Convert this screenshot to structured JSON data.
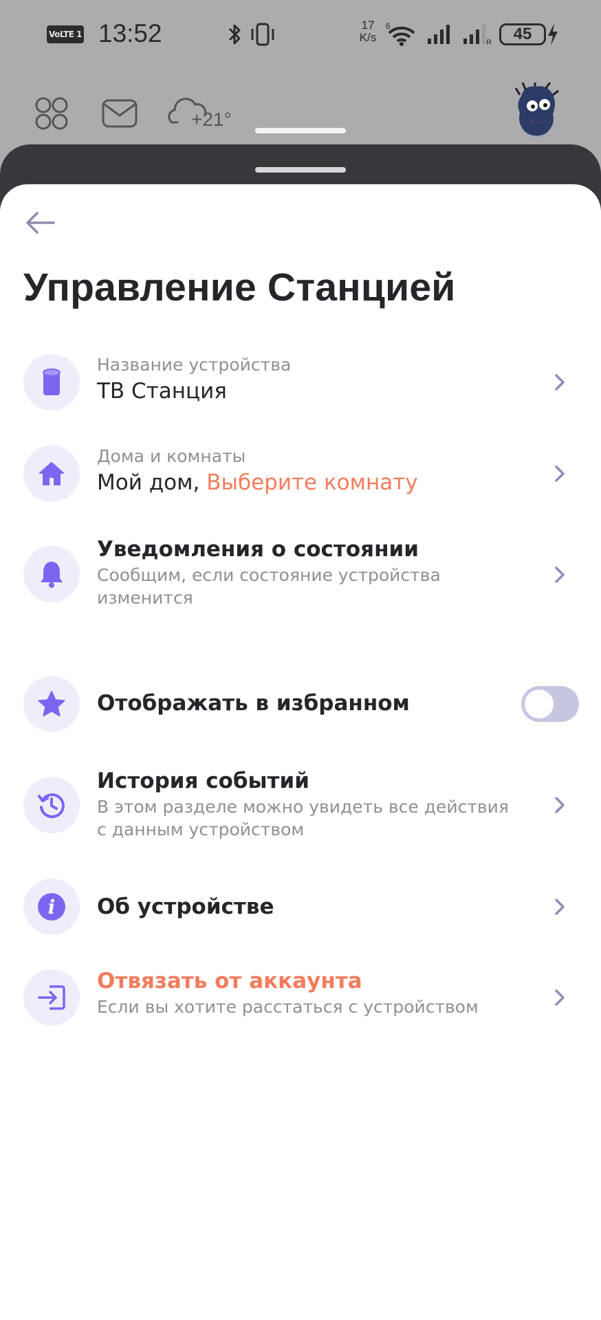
{
  "status_bar": {
    "volte": "VoLTE 1",
    "time": "13:52",
    "speed_value": "17",
    "speed_unit": "K/s",
    "battery": "45"
  },
  "launcher": {
    "weather_temp": "+21°"
  },
  "page": {
    "title": "Управление Станцией"
  },
  "rows": {
    "device_name": {
      "caption": "Название устройства",
      "value": "ТВ Станция"
    },
    "homes": {
      "caption": "Дома и комнаты",
      "value": "Мой дом,",
      "action": "Выберите комнату"
    },
    "notifications": {
      "title": "Уведомления о состоянии",
      "subtitle_line1": "Сообщим, если состояние устройства",
      "subtitle_line2": "изменится"
    },
    "favorites": {
      "title": "Отображать в избранном",
      "enabled": false
    },
    "history": {
      "title": "История событий",
      "subtitle_line1": "В этом разделе можно увидеть все действия",
      "subtitle_line2": "с данным устройством"
    },
    "about": {
      "title": "Об устройстве"
    },
    "unlink": {
      "title": "Отвязать от аккаунта",
      "subtitle": "Если вы хотите расстаться с устройством"
    }
  },
  "colors": {
    "icon_accent": "#7b66f0",
    "icon_bg": "#f0edfb",
    "warning_text": "#f27c5c",
    "chevron": "#8c8fb4",
    "toggle_off": "#c5c6e0"
  }
}
